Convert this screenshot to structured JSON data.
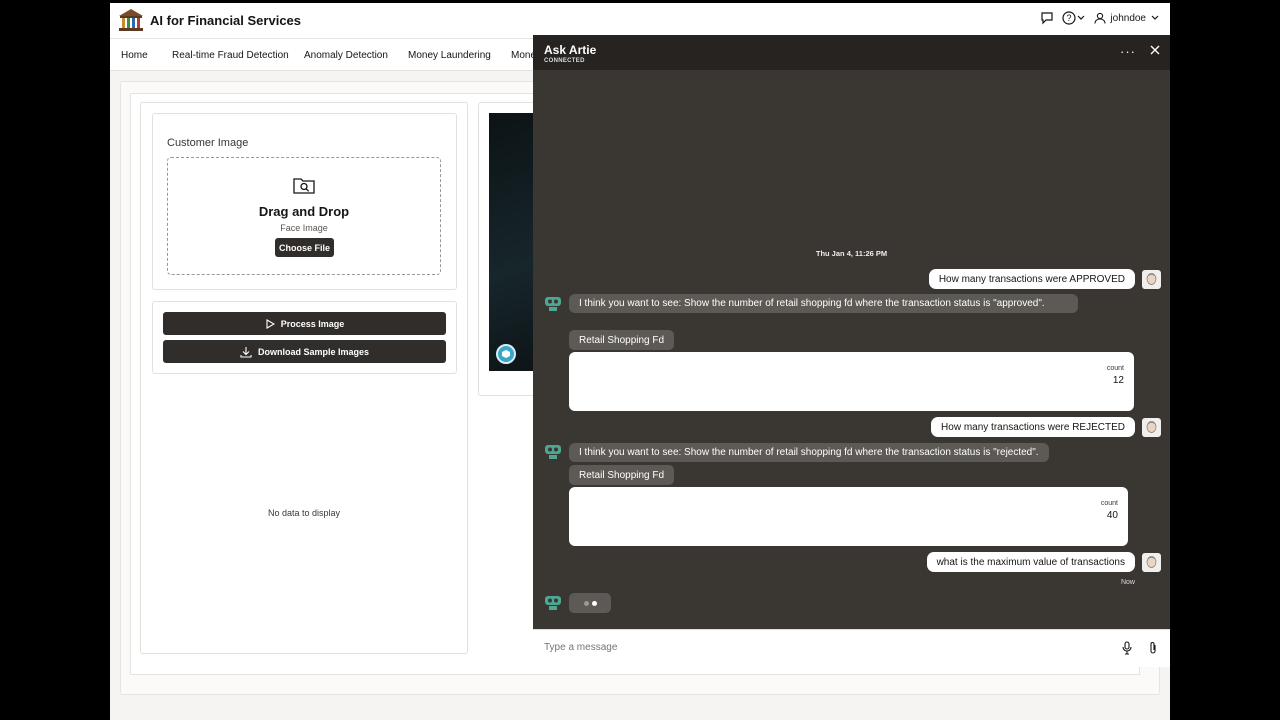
{
  "header": {
    "app_title": "AI for Financial Services",
    "user_name": "johndoe"
  },
  "nav": {
    "items": [
      "Home",
      "Real-time Fraud Detection",
      "Anomaly Detection",
      "Money Laundering",
      "Mone"
    ]
  },
  "upload": {
    "section_label": "Customer Image",
    "title": "Drag and Drop",
    "subtitle": "Face Image",
    "choose_label": "Choose File"
  },
  "actions": {
    "process_label": "Process Image",
    "download_label": "Download Sample Images"
  },
  "results": {
    "empty_text": "No data to display"
  },
  "chat": {
    "title": "Ask Artie",
    "status": "CONNECTED",
    "timestamp": "Thu Jan 4, 11:26 PM",
    "messages": [
      {
        "user": "How many transactions were APPROVED",
        "bot": "I think you want to see: Show the number of retail shopping fd where the transaction status is \"approved\".",
        "chip": "Retail Shopping Fd",
        "result_label": "count",
        "result_value": "12"
      },
      {
        "user": "How many transactions were REJECTED",
        "bot": "I think you want to see: Show the number of retail shopping fd where the transaction status is \"rejected\".",
        "chip": "Retail Shopping Fd",
        "result_label": "count",
        "result_value": "40"
      },
      {
        "user": "what is the maximum value of transactions"
      }
    ],
    "now_label": "Now",
    "input_placeholder": "Type a message"
  }
}
